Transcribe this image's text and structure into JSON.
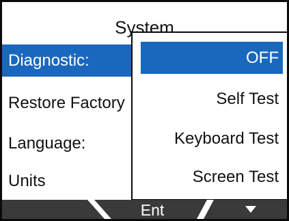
{
  "screen": {
    "title": "System"
  },
  "menu": {
    "items": [
      {
        "label": "Diagnostic:",
        "selected": true
      },
      {
        "label": "Restore Factory",
        "selected": false
      },
      {
        "label": "Language:",
        "selected": false
      },
      {
        "label": "Units",
        "selected": false
      }
    ]
  },
  "popup": {
    "options": [
      {
        "label": "OFF",
        "selected": true
      },
      {
        "label": "Self Test",
        "selected": false
      },
      {
        "label": "Keyboard Test",
        "selected": false
      },
      {
        "label": "Screen Test",
        "selected": false
      }
    ]
  },
  "softkeys": {
    "left_label": "",
    "center_label": "Ent",
    "right_icon": "down-arrow-icon"
  },
  "colors": {
    "selection": "#1a68be",
    "softkey_bar": "#3a3a3a",
    "frame": "#0a0a0a"
  }
}
